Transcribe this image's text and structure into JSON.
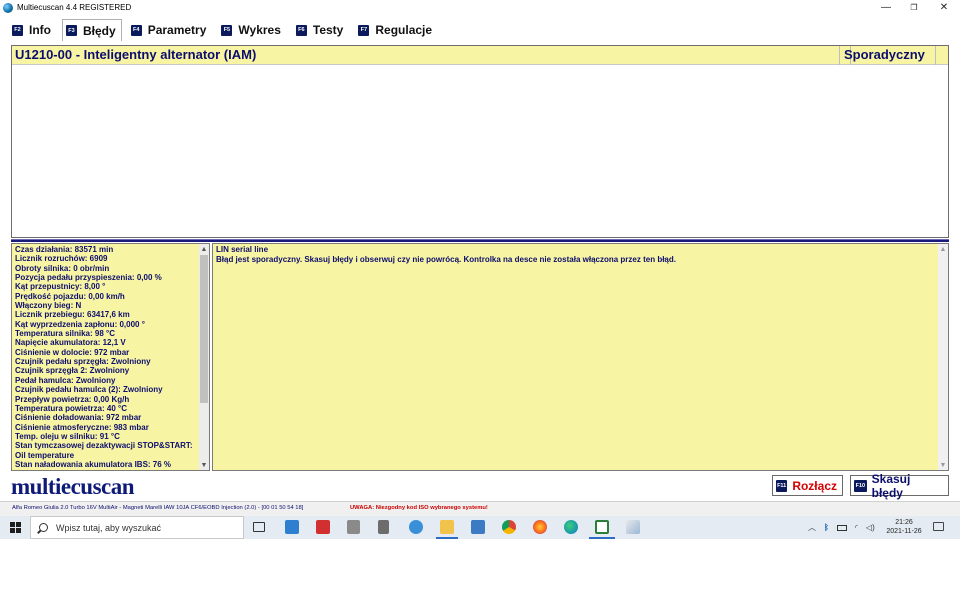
{
  "window": {
    "title": "Multiecuscan 4.4 REGISTERED",
    "controls": [
      "—",
      "❐",
      "✕"
    ]
  },
  "tabs": [
    {
      "key": "F2",
      "label": "Info",
      "active": false
    },
    {
      "key": "F3",
      "label": "Błędy",
      "active": true
    },
    {
      "key": "F4",
      "label": "Parametry",
      "active": false
    },
    {
      "key": "F5",
      "label": "Wykres",
      "active": false
    },
    {
      "key": "F6",
      "label": "Testy",
      "active": false
    },
    {
      "key": "F7",
      "label": "Regulacje",
      "active": false
    }
  ],
  "faults": {
    "code": "U1210-00 - Inteligentny alternator (IAM)",
    "status": "Sporadyczny"
  },
  "parameters": [
    "Czas działania: 83571 min",
    "Licznik rozruchów: 6909",
    "Obroty silnika: 0 obr/min",
    "Pozycja pedału przyspieszenia: 0,00 %",
    "Kąt przepustnicy: 8,00 °",
    "Prędkość pojazdu: 0,00 km/h",
    "Włączony bieg: N",
    "Licznik przebiegu: 63417,6 km",
    "Kąt wyprzedzenia zapłonu: 0,000 °",
    "Temperatura silnika: 98 °C",
    "Napięcie akumulatora: 12,1 V",
    "Ciśnienie w dolocie: 972 mbar",
    "Czujnik pedału sprzęgła: Zwolniony",
    "Czujnik sprzęgła 2: Zwolniony",
    "Pedał hamulca: Zwolniony",
    "Czujnik pedału hamulca (2): Zwolniony",
    "Przepływ powietrza: 0,00 Kg/h",
    "Temperatura powietrza: 40 °C",
    "Ciśnienie doładowania: 972 mbar",
    "Ciśnienie atmosferyczne: 983 mbar",
    "Temp. oleju w silniku: 91 °C",
    "Stan tymczasowej dezaktywacji STOP&START:",
    "Oil temperature",
    "Stan naładowania akumulatora IBS: 76 %"
  ],
  "description": {
    "title": "LIN serial line",
    "text": "Błąd jest sporadyczny. Skasuj błędy i obserwuj czy nie powrócą. Kontrolka na desce nie została włączona przez ten błąd."
  },
  "logo": "multiecuscan",
  "buttons": {
    "disconnect": {
      "key": "F11",
      "label": "Rozłącz",
      "color": "#d40000"
    },
    "clear": {
      "key": "F10",
      "label": "Skasuj błędy",
      "color": "#0d0d6e"
    }
  },
  "statusbar": {
    "vehicle": "Alfa Romeo Giulia 2.0 Turbo 16V MultiAir - Magneti Marelli IAW 10JA CF6/EOBD Injection (2.0) - [00 01 50 54 18]",
    "warning": "UWAGA: Niezgodny kod ISO wybranego systemu!"
  },
  "taskbar": {
    "search_placeholder": "Wpisz tutaj, aby wyszukać",
    "time": "21:26",
    "date": "2021-11-26"
  },
  "colors": {
    "panel_yellow": "#f7f5a3",
    "text_navy": "#0d0d6e",
    "accent_red": "#d40000"
  }
}
